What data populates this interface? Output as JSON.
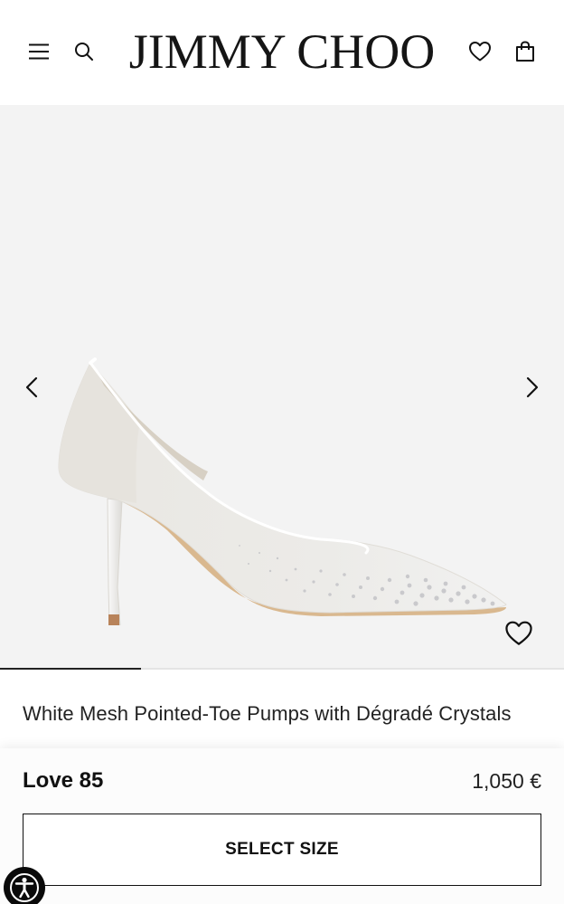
{
  "header": {
    "brand": "JIMMY CHOO",
    "menu_icon": "hamburger-menu-icon",
    "search_icon": "search-icon",
    "wishlist_icon": "heart-icon",
    "bag_icon": "shopping-bag-icon"
  },
  "gallery": {
    "prev_icon": "chevron-left-icon",
    "next_icon": "chevron-right-icon",
    "wishlist_icon": "heart-icon",
    "progress_fraction": 0.25,
    "background": "#f3f3f3"
  },
  "product": {
    "title": "White Mesh Pointed-Toe Pumps with Dégradé Crystals",
    "model": "Love 85",
    "price": "1,050 €",
    "select_size_label": "SELECT SIZE"
  },
  "accessibility": {
    "icon": "accessibility-icon"
  },
  "colors": {
    "text": "#111111",
    "gallery_bg": "#f3f3f3",
    "accessibility_bg": "#0a0a0a"
  }
}
